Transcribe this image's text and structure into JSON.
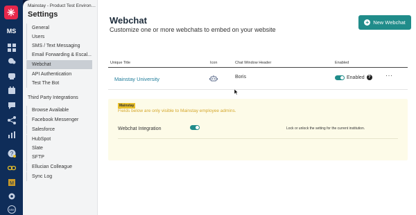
{
  "rail": {
    "initials": "MS",
    "icons": [
      "star-logo",
      "dashboard",
      "contacts",
      "chat",
      "calendar",
      "messages",
      "share",
      "reports",
      "help",
      "link",
      "badge",
      "settings",
      "avatar"
    ],
    "badge_letter": "M",
    "avatar_text": "MM"
  },
  "nav": {
    "crumb": "Mainstay - Product Test Environm...",
    "title": "Settings",
    "items": [
      "General",
      "Users",
      "SMS / Text Messaging",
      "Email Forwarding & Escal...",
      "Webchat",
      "API Authentication",
      "Test The Bot"
    ],
    "third_party_title": "Third Party Integrations",
    "integrations": [
      "Browse Available",
      "Facebook Messenger",
      "Salesforce",
      "HubSpot",
      "Slate",
      "SFTP",
      "Ellucian Colleague",
      "Sync Log"
    ]
  },
  "main": {
    "heading": "Webchat",
    "subheading": "Customize one or more webchats to embed on your website",
    "new_button": "New Webchat",
    "columns": [
      "Unique Title",
      "Icon",
      "Chat Window Header",
      "Enabled"
    ],
    "row": {
      "title": "Mainstay University",
      "header": "Boris",
      "enabled_label": "Enabled",
      "help": "?",
      "more": "···"
    },
    "panel": {
      "tag": "Mainstay",
      "warning": "Fields below are only visible to Mainstay employee admins.",
      "label": "Webchat Integration",
      "description": "Lock or unlock the setting for the current institution."
    }
  },
  "colors": {
    "brand": "#208c8a",
    "rail": "#0f2d59",
    "logo": "#e8274b",
    "warning": "#d4a62a",
    "link": "#1f7c9a"
  }
}
